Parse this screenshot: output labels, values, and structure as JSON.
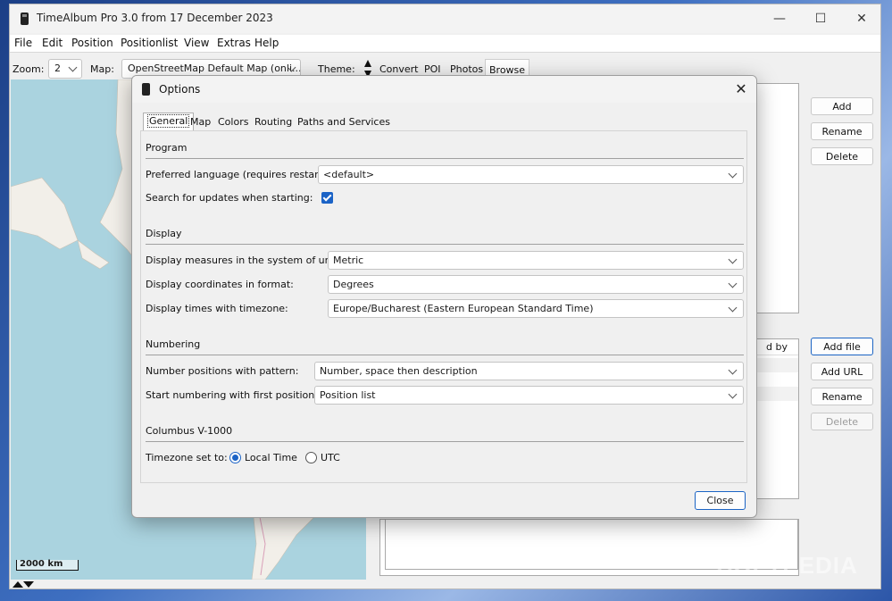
{
  "window": {
    "title": "TimeAlbum Pro 3.0 from 17 December 2023",
    "minimize_glyph": "—",
    "maximize_glyph": "☐",
    "close_glyph": "✕"
  },
  "menu": [
    "File",
    "Edit",
    "Position",
    "Positionlist",
    "View",
    "Extras",
    "Help"
  ],
  "toolbar": {
    "zoom_label": "Zoom:",
    "zoom_value": "2",
    "map_label": "Map:",
    "map_value": "OpenStreetMap Default Map (onli...",
    "theme_label": "Theme:",
    "tabs": [
      "Convert",
      "POI",
      "Photos",
      "Browse"
    ],
    "active_tab": "Browse"
  },
  "map": {
    "scale_label": "2000 km"
  },
  "right_panel": {
    "top_buttons": [
      "Add",
      "Rename",
      "Delete"
    ],
    "file_buttons": [
      "Add file",
      "Add URL",
      "Rename",
      "Delete"
    ],
    "files_column_fragment": "d by"
  },
  "watermark": "SOFTPEDIA",
  "dialog": {
    "title": "Options",
    "close_glyph": "✕",
    "tabs": [
      "General",
      "Map",
      "Colors",
      "Routing",
      "Paths and Services"
    ],
    "active_tab": "General",
    "sections": {
      "program": "Program",
      "display": "Display",
      "numbering": "Numbering",
      "columbus": "Columbus V-1000"
    },
    "fields": {
      "language_label": "Preferred language (requires restart):",
      "language_value": "<default>",
      "updates_label": "Search for updates when starting:",
      "updates_checked": true,
      "units_label": "Display measures in the system of units:",
      "units_value": "Metric",
      "coords_label": "Display coordinates in format:",
      "coords_value": "Degrees",
      "timezone_label": "Display times with timezone:",
      "timezone_value": "Europe/Bucharest (Eastern European Standard Time)",
      "pattern_label": "Number positions with pattern:",
      "pattern_value": "Number, space then description",
      "start_label": "Start numbering with first position of:",
      "start_value": "Position list",
      "tz_set_label": "Timezone set to:",
      "tz_local": "Local Time",
      "tz_utc": "UTC",
      "tz_selected": "Local Time"
    },
    "close_button": "Close"
  }
}
